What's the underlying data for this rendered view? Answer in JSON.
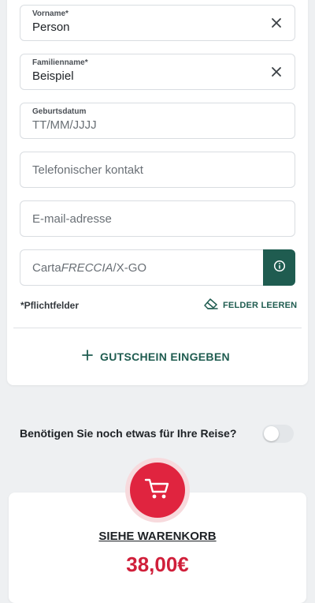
{
  "form": {
    "first_name": {
      "label": "Vorname*",
      "value": "Person"
    },
    "last_name": {
      "label": "Familienname*",
      "value": "Beispiel"
    },
    "birthdate": {
      "label": "Geburtsdatum",
      "placeholder": "TT/MM/JJJJ"
    },
    "phone": {
      "placeholder": "Telefonischer kontakt"
    },
    "email": {
      "placeholder": "E-mail-adresse"
    },
    "card": {
      "placeholder_prefix": "Carta",
      "placeholder_italic": "FRECCIA",
      "placeholder_suffix": "/X-GO"
    },
    "required_note": "*Pflichtfelder",
    "clear_fields_label": "FELDER LEEREN",
    "voucher_label": "GUTSCHEIN EINGEBEN"
  },
  "extras": {
    "question": "Benötigen Sie noch etwas für Ihre Reise?",
    "toggle_on": false
  },
  "cart": {
    "link_label": "SIEHE WARENKORB",
    "total": "38,00€"
  },
  "colors": {
    "accent_green": "#1f5c50",
    "accent_red": "#e0243f",
    "price_red": "#d01f3a"
  },
  "icons": [
    "close-icon",
    "info-icon",
    "eraser-icon",
    "plus-icon",
    "cart-icon"
  ]
}
